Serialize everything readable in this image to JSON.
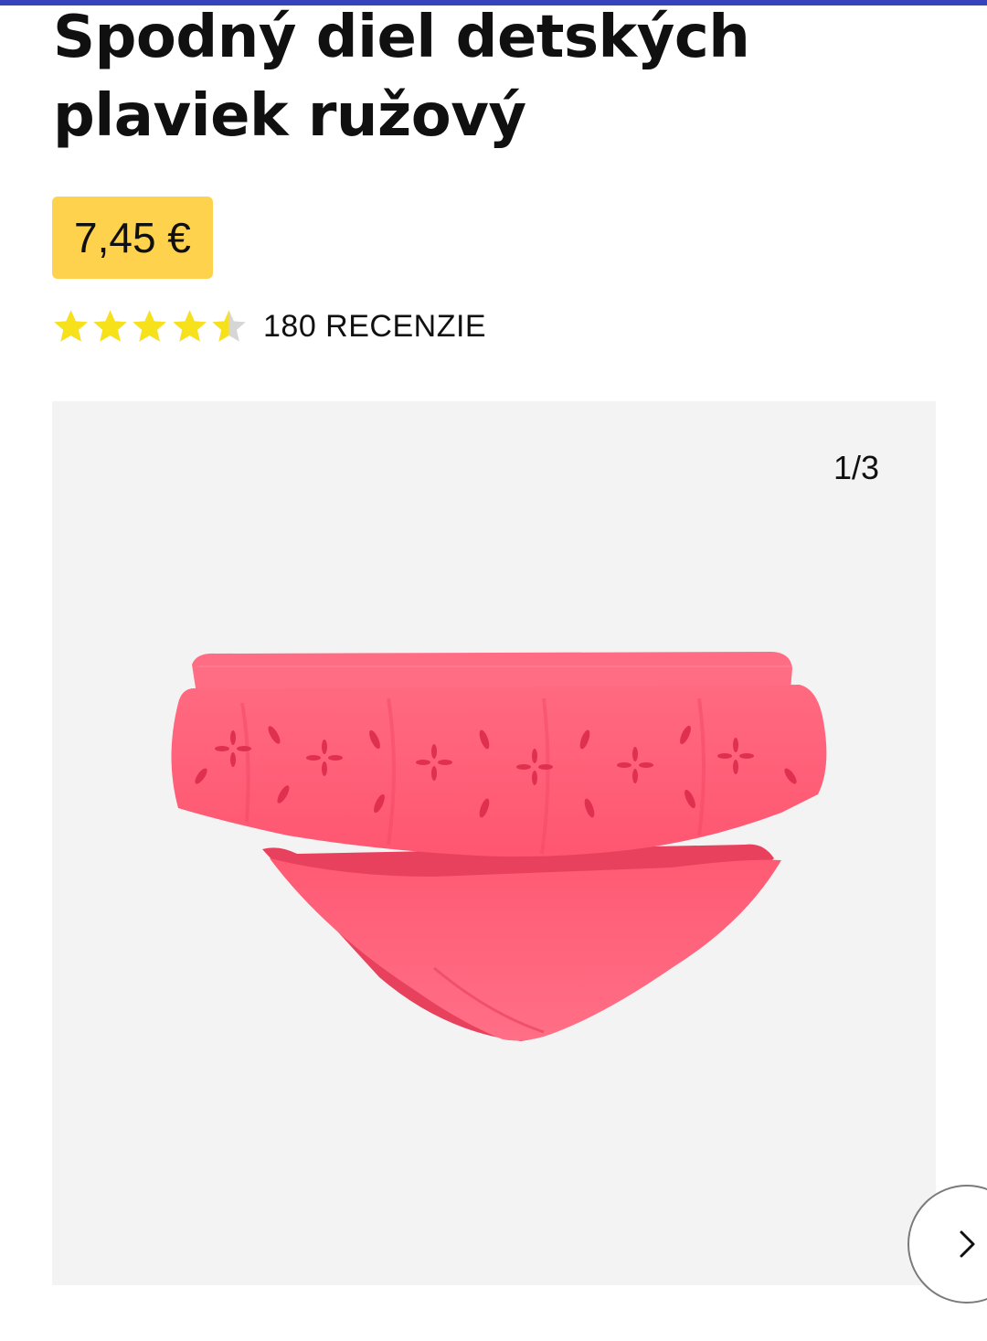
{
  "colors": {
    "top_accent": "#3643ba",
    "price_badge": "#ffd24d",
    "star_filled": "#f7e11a",
    "star_empty": "#d6d6d6",
    "gallery_background": "#f4f3f3",
    "product_pink": "#ff4f6d"
  },
  "product": {
    "title": "Spodný diel detských plaviek ružový",
    "price": "7,45 €"
  },
  "rating": {
    "value": 4.5,
    "max": 5,
    "review_count_label": "180 RECENZIE"
  },
  "gallery": {
    "counter": "1/3",
    "current_index": 1,
    "total": 3,
    "image_icon": "pink-ruffle-bikini-bottom-image",
    "next_icon": "chevron-right-icon"
  }
}
